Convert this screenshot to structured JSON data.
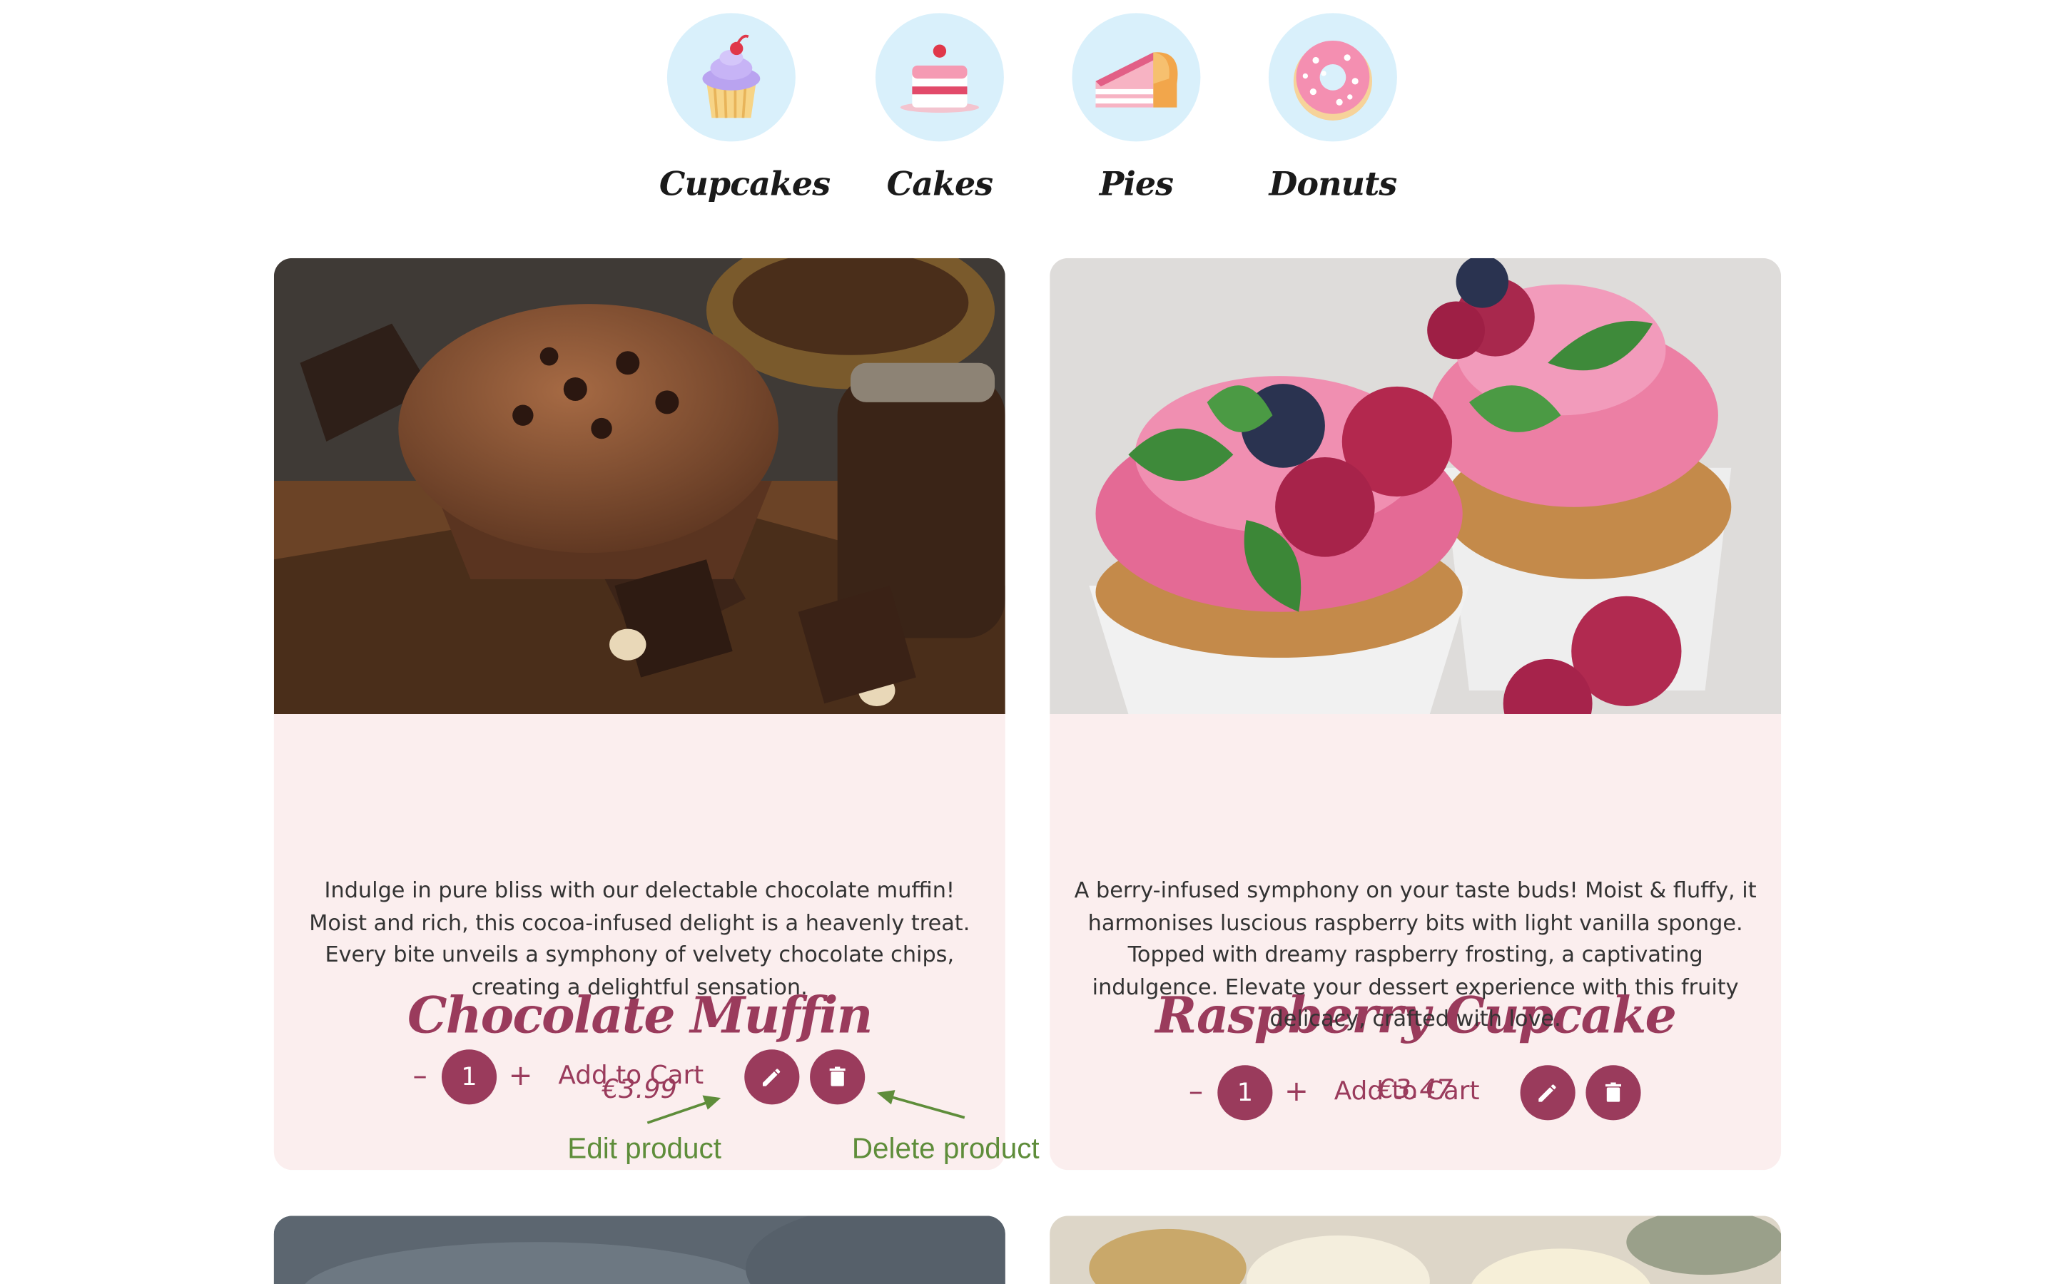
{
  "categories": [
    {
      "label": "Cupcakes",
      "icon": "cupcake-icon"
    },
    {
      "label": "Cakes",
      "icon": "cake-icon"
    },
    {
      "label": "Pies",
      "icon": "pie-slice-icon"
    },
    {
      "label": "Donuts",
      "icon": "donut-icon"
    }
  ],
  "products": [
    {
      "title": "Chocolate Muffin",
      "price": "€3.99",
      "description_lines": [
        "Indulge in pure bliss with our delectable chocolate muffin!",
        "Moist and rich, this cocoa-infused delight is a heavenly treat.",
        "Every bite unveils a symphony of velvety chocolate chips,",
        "creating a delightful sensation."
      ],
      "quantity": "1",
      "decrement": "–",
      "increment": "+",
      "add_to_cart": "Add to Cart",
      "image": "chocolate-muffin-photo"
    },
    {
      "title": "Raspberry Cupcake",
      "price": "€3.47",
      "description_lines": [
        "A berry-infused symphony on your taste buds! Moist & fluffy, it",
        "harmonises luscious raspberry bits with light vanilla sponge.",
        "Topped with dreamy raspberry frosting, a captivating",
        "indulgence. Elevate your dessert experience with this fruity",
        "delicacy, crafted with love."
      ],
      "quantity": "1",
      "decrement": "–",
      "increment": "+",
      "add_to_cart": "Add to Cart",
      "image": "raspberry-cupcake-photo"
    }
  ],
  "annotations": {
    "edit": "Edit product",
    "delete": "Delete product"
  },
  "colors": {
    "accent": "#9a3b5c",
    "card_bg": "#fbeeee",
    "category_circle": "#d9f0fb",
    "annotation": "#5e8d3a"
  }
}
